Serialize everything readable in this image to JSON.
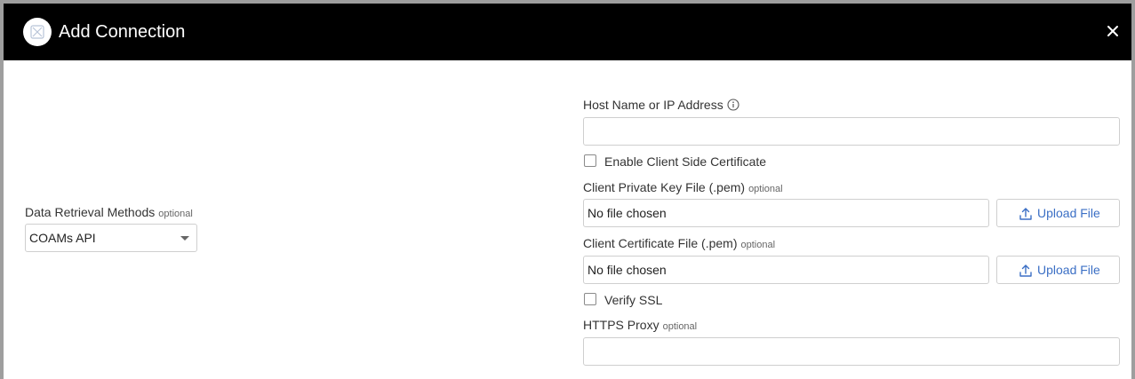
{
  "dialog": {
    "title": "Add Connection",
    "logo_icon": "connector-logo-icon",
    "close_icon": "close-icon"
  },
  "left": {
    "data_retrieval": {
      "label": "Data Retrieval Methods",
      "optional": "optional",
      "selected": "COAMs API"
    }
  },
  "right": {
    "host": {
      "label": "Host Name or IP Address",
      "info_icon": "info-icon",
      "value": ""
    },
    "client_cert_toggle": {
      "label": "Enable Client Side Certificate",
      "checked": false
    },
    "private_key": {
      "label": "Client Private Key File (.pem)",
      "optional": "optional",
      "file_text": "No file chosen",
      "upload_label": "Upload File"
    },
    "client_cert": {
      "label": "Client Certificate File (.pem)",
      "optional": "optional",
      "file_text": "No file chosen",
      "upload_label": "Upload File"
    },
    "verify_ssl": {
      "label": "Verify SSL",
      "checked": false
    },
    "https_proxy": {
      "label": "HTTPS Proxy",
      "optional": "optional",
      "value": ""
    }
  },
  "colors": {
    "header_bg": "#000000",
    "accent_link": "#3b6fc5",
    "border": "#cfcfcf"
  }
}
